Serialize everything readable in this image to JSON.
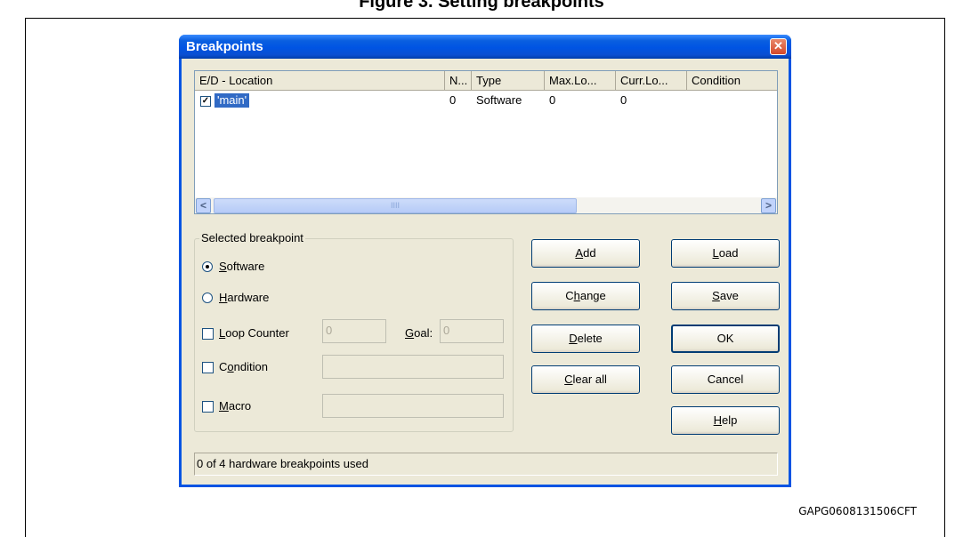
{
  "page_title": "Figure 3. Setting breakpoints",
  "figure_id": "GAPG0608131506CFT",
  "dialog": {
    "title": "Breakpoints",
    "close_glyph": "✕"
  },
  "list": {
    "columns": [
      "E/D - Location",
      "N...",
      "Type",
      "Max.Lo...",
      "Curr.Lo...",
      "Condition"
    ],
    "rows": [
      {
        "enabled": true,
        "location": "'main'",
        "n": "0",
        "type": "Software",
        "max": "0",
        "curr": "0",
        "condition": ""
      }
    ],
    "scroll_left": "<",
    "scroll_right": ">",
    "scroll_grip": "IIII"
  },
  "selected_breakpoint": {
    "group_label": "Selected breakpoint",
    "software": {
      "pre": "",
      "key": "S",
      "post": "oftware"
    },
    "hardware": {
      "pre": "",
      "key": "H",
      "post": "ardware"
    },
    "loop_counter": {
      "pre": "",
      "key": "L",
      "post": "oop Counter",
      "value": "0"
    },
    "goal": {
      "pre": "",
      "key": "G",
      "post": "oal:",
      "value": "0"
    },
    "condition": {
      "pre": "C",
      "key": "o",
      "post": "ndition",
      "value": ""
    },
    "macro": {
      "pre": "",
      "key": "M",
      "post": "acro",
      "value": ""
    },
    "type_selected": "software"
  },
  "buttons": {
    "add": {
      "pre": "",
      "key": "A",
      "post": "dd"
    },
    "change": {
      "pre": "C",
      "key": "h",
      "post": "ange"
    },
    "delete": {
      "pre": "",
      "key": "D",
      "post": "elete"
    },
    "clear_all": {
      "pre": "",
      "key": "C",
      "post": "lear all"
    },
    "load": {
      "pre": "",
      "key": "L",
      "post": "oad"
    },
    "save": {
      "pre": "",
      "key": "S",
      "post": "ave"
    },
    "ok": "OK",
    "cancel": "Cancel",
    "help": {
      "pre": "",
      "key": "H",
      "post": "elp"
    }
  },
  "status": "0 of 4  hardware breakpoints used"
}
